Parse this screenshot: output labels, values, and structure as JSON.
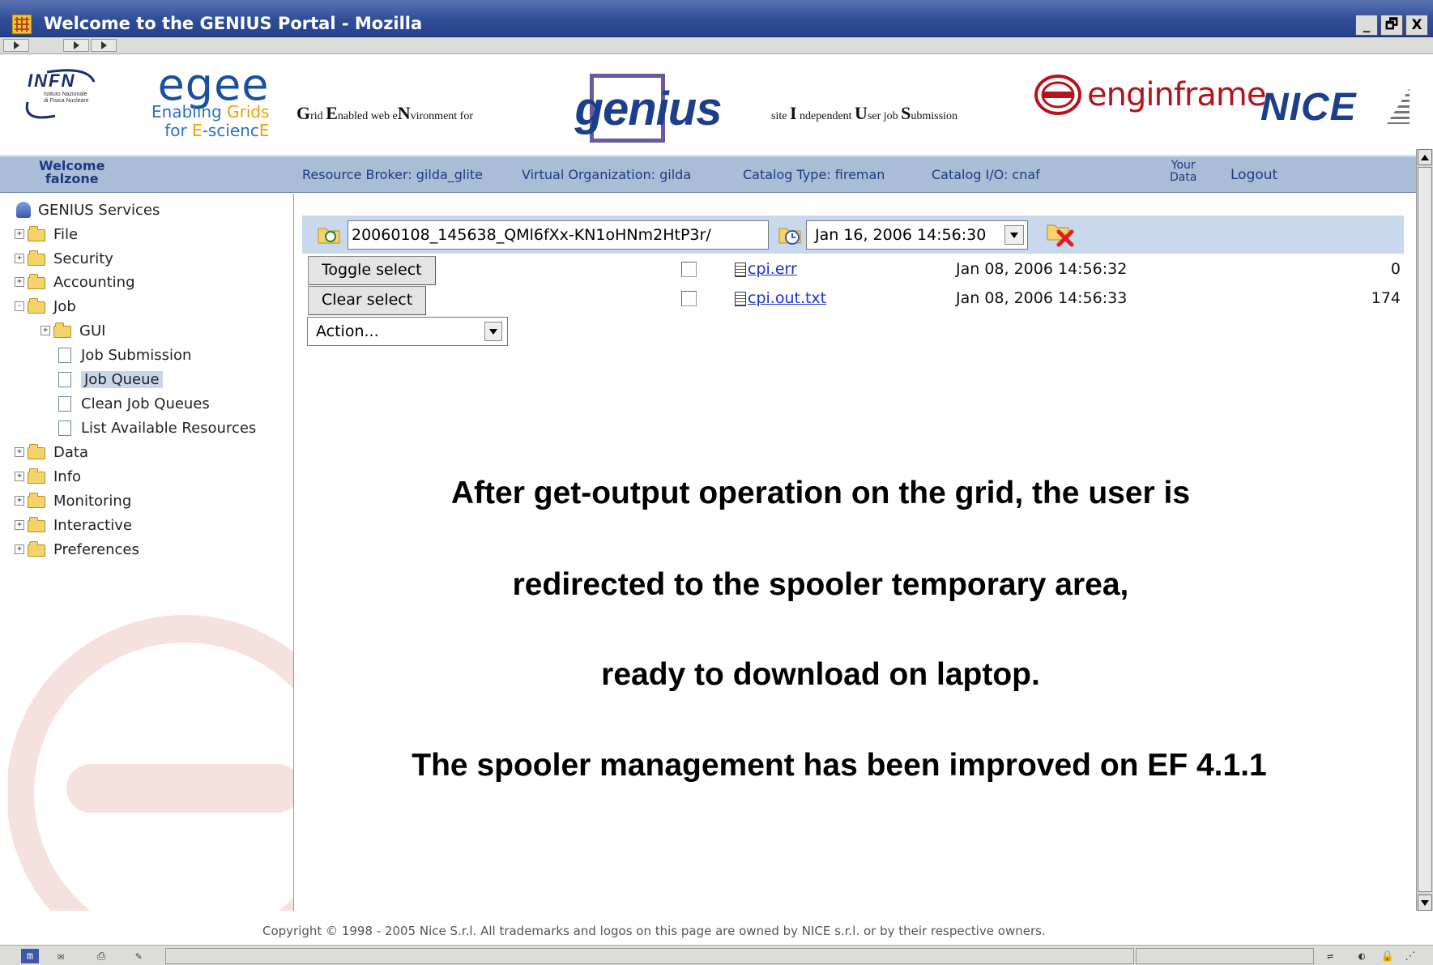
{
  "window": {
    "title": "Welcome to the GENIUS Portal - Mozilla",
    "controls": [
      "_",
      "🗗",
      "X"
    ]
  },
  "banner": {
    "infn": {
      "name": "INFN",
      "subtitle_line1": "Istituto Nazionale",
      "subtitle_line2": "di Fisica Nucleare"
    },
    "egee": {
      "name": "egee",
      "line1_a": "Enabling ",
      "line1_b": "Grids",
      "line2_a": "for ",
      "line2_b": "E",
      "line2_c": "-scienc",
      "line2_d": "E"
    },
    "grid_text": {
      "G": "G",
      "rid": "rid ",
      "E": "E",
      "nabled": "nabled web e",
      "N": "N",
      "vironment": "vironment for"
    },
    "genius": "genius",
    "site_text": {
      "pre": "site ",
      "I": "I",
      "ndependent": " ndependent ",
      "U": "U",
      "ser": "ser job ",
      "S": "S",
      "ubmission": "ubmission"
    },
    "enginframe": "enginframe",
    "nice": "NICE"
  },
  "infobar": {
    "welcome_line1": "Welcome",
    "welcome_line2": "falzone",
    "resource_broker": "Resource Broker: gilda_glite",
    "virtual_org": "Virtual Organization: gilda",
    "catalog_type": "Catalog Type: fireman",
    "catalog_io": "Catalog I/O: cnaf",
    "your_data_line1": "Your",
    "your_data_line2": "Data",
    "logout": "Logout"
  },
  "sidebar": {
    "root": "GENIUS Services",
    "items": [
      {
        "label": "File",
        "expander": "+"
      },
      {
        "label": "Security",
        "expander": "+"
      },
      {
        "label": "Accounting",
        "expander": "+"
      },
      {
        "label": "Job",
        "expander": "-"
      },
      {
        "label": "GUI",
        "expander": "+"
      },
      {
        "label": "Job Submission"
      },
      {
        "label": "Job Queue",
        "selected": true
      },
      {
        "label": "Clean Job Queues"
      },
      {
        "label": "List Available Resources"
      },
      {
        "label": "Data",
        "expander": "+"
      },
      {
        "label": "Info",
        "expander": "+"
      },
      {
        "label": "Monitoring",
        "expander": "+"
      },
      {
        "label": "Interactive",
        "expander": "+"
      },
      {
        "label": "Preferences",
        "expander": "+"
      }
    ]
  },
  "spooler": {
    "path_value": "20060108_145638_QMl6fXx-KN1oHNm2HtP3r/",
    "date_value": "Jan 16, 2006 14:56:30",
    "toggle_select": "Toggle select",
    "clear_select": "Clear select",
    "action_select": "Action...",
    "files": [
      {
        "name": "cpi.err",
        "date": "Jan 08, 2006 14:56:32",
        "size": "0"
      },
      {
        "name": "cpi.out.txt",
        "date": "Jan 08, 2006 14:56:33",
        "size": "174"
      }
    ]
  },
  "notes": {
    "line1": "After get-output operation on the grid, the user is",
    "line2": "redirected to the spooler temporary area,",
    "line3": "ready to download on laptop.",
    "line4": "The spooler management has been improved on EF 4.1.1"
  },
  "footer": {
    "copyright": "Copyright © 1998 - 2005 Nice S.r.l. All trademarks and logos on this page are owned by NICE s.r.l. or by their respective owners."
  },
  "colors": {
    "titlebar": "#2f4d97",
    "infobar": "#a9bdd6",
    "link": "#1a33cc",
    "pathbar": "#c9d8ec"
  }
}
